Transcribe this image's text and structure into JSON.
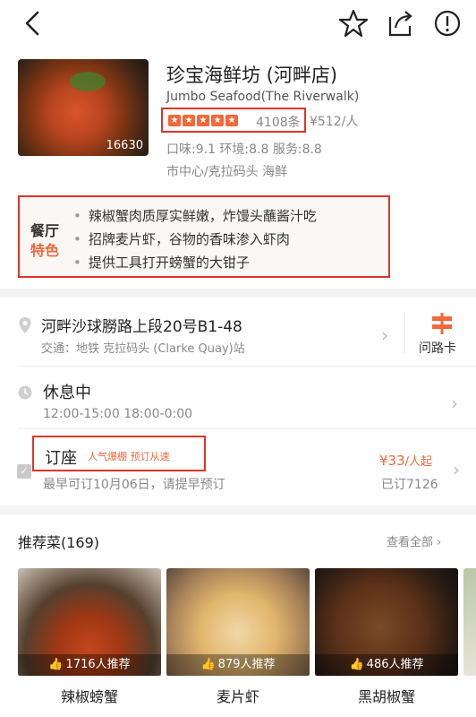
{
  "colors": {
    "accent": "#f2683a",
    "highlight_box": "#e0352b",
    "muted_text": "#888888"
  },
  "topbar": {
    "icons": [
      "back-icon",
      "star-icon",
      "share-icon",
      "more-icon"
    ]
  },
  "shop": {
    "name": "珍宝海鲜坊 (河畔店)",
    "english_name": "Jumbo Seafood(The Riverwalk)",
    "photo_count": "16630",
    "rating_stars": 5,
    "reviews": "4108条",
    "price": "¥512/人",
    "scores": "口味:9.1  环境:8.8  服务:8.8",
    "tags": "市中心/克拉码头   海鲜"
  },
  "features": {
    "label_line1": "餐厅",
    "label_line2": "特色",
    "items": [
      "辣椒蟹肉质厚实鲜嫩，炸馒头蘸酱汁吃",
      "招牌麦片虾，谷物的香味渗入虾肉",
      "提供工具打开螃蟹的大钳子"
    ]
  },
  "address": {
    "line1": "河畔沙球朥路上段20号B1-48",
    "line2": "交通：地铁 克拉码头 (Clarke Quay)站",
    "card_label": "问路卡"
  },
  "hours": {
    "status": "休息中",
    "times": "12:00-15:00 18:00-0:00"
  },
  "booking": {
    "title": "订座",
    "hot_tag": "人气爆棚 预订从速",
    "subtitle": "最早可订10月06日，请提早预订",
    "price": "¥33",
    "price_unit": "/人起",
    "booked": "已订7126"
  },
  "recommended": {
    "title": "推荐菜(169)",
    "view_all": "查看全部",
    "dishes": [
      {
        "name": "辣椒螃蟹",
        "recommend": "1716人推荐"
      },
      {
        "name": "麦片虾",
        "recommend": "879人推荐"
      },
      {
        "name": "黑胡椒蟹",
        "recommend": "486人推荐"
      }
    ]
  }
}
